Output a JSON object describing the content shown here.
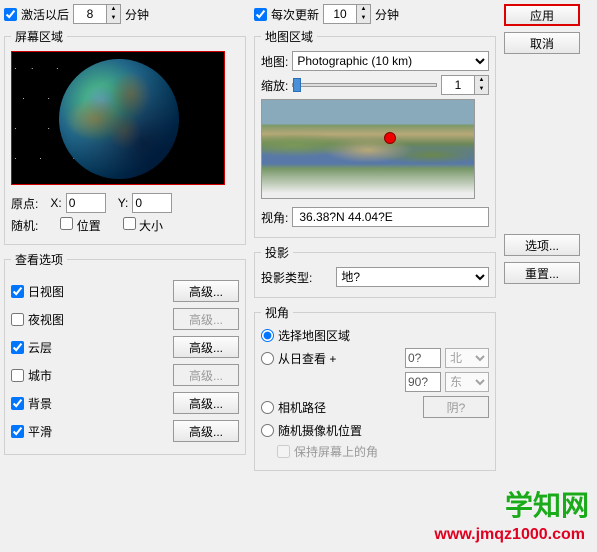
{
  "top": {
    "activate_after": "激活以后",
    "activate_value": "8",
    "minutes": "分钟",
    "every_update": "每次更新",
    "update_value": "10"
  },
  "buttons_right": {
    "apply": "应用",
    "cancel": "取消",
    "options": "选项...",
    "reset": "重置..."
  },
  "screen_region": {
    "legend": "屏幕区域",
    "origin": "原点:",
    "x_label": "X:",
    "x_value": "0",
    "y_label": "Y:",
    "y_value": "0",
    "random": "随机:",
    "position": "位置",
    "size": "大小"
  },
  "view_options": {
    "legend": "查看选项",
    "day_view": "日视图",
    "night_view": "夜视图",
    "clouds": "云层",
    "city": "城市",
    "background": "背景",
    "smooth": "平滑",
    "advanced": "高级..."
  },
  "map_region": {
    "legend": "地图区域",
    "map_label": "地图:",
    "map_value": "Photographic (10 km)",
    "zoom_label": "缩放:",
    "zoom_value": "1",
    "view_angle": "视角:",
    "coords": "36.38?N  44.04?E"
  },
  "projection": {
    "legend": "投影",
    "type_label": "投影类型:",
    "type_value": "地?"
  },
  "angle": {
    "legend": "视角",
    "select_map_region": "选择地图区域",
    "from_sun": "从日查看 +",
    "val1": "0?",
    "dir1": "北",
    "val2": "90?",
    "dir2": "东",
    "camera_path": "相机路径",
    "random_cam": "随机摄像机位置",
    "keep_screen": "保持屏幕上的角",
    "shadow_btn": "阴?"
  },
  "watermark": {
    "text": "学知网",
    "url": "www.jmqz1000.com"
  }
}
